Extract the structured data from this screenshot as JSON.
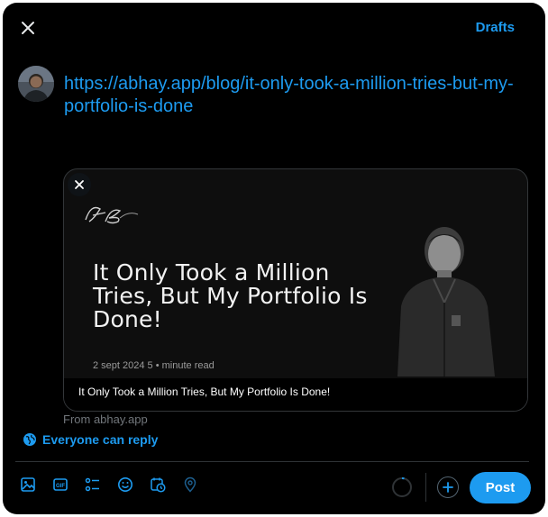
{
  "header": {
    "close_icon": "close-icon",
    "drafts_label": "Drafts"
  },
  "composer": {
    "text": "https://abhay.app/blog/it-only-took-a-million-tries-but-my-portfolio-is-done"
  },
  "link_card": {
    "logo_text": "AB",
    "headline": "It Only Took a Million Tries, But My Portfolio Is Done!",
    "meta": "2 sept 2024 5 • minute read",
    "caption": "It Only Took a Million Tries, But My Portfolio Is Done!",
    "source": "From abhay.app"
  },
  "reply_setting": {
    "label": "Everyone can reply",
    "icon": "globe-icon"
  },
  "toolbar": {
    "icons": [
      "image-icon",
      "gif-icon",
      "poll-icon",
      "emoji-icon",
      "schedule-icon",
      "location-icon"
    ],
    "post_label": "Post"
  },
  "colors": {
    "accent": "#1d9bf0",
    "background": "#000000",
    "muted": "#71767b",
    "border": "#2f3336"
  }
}
